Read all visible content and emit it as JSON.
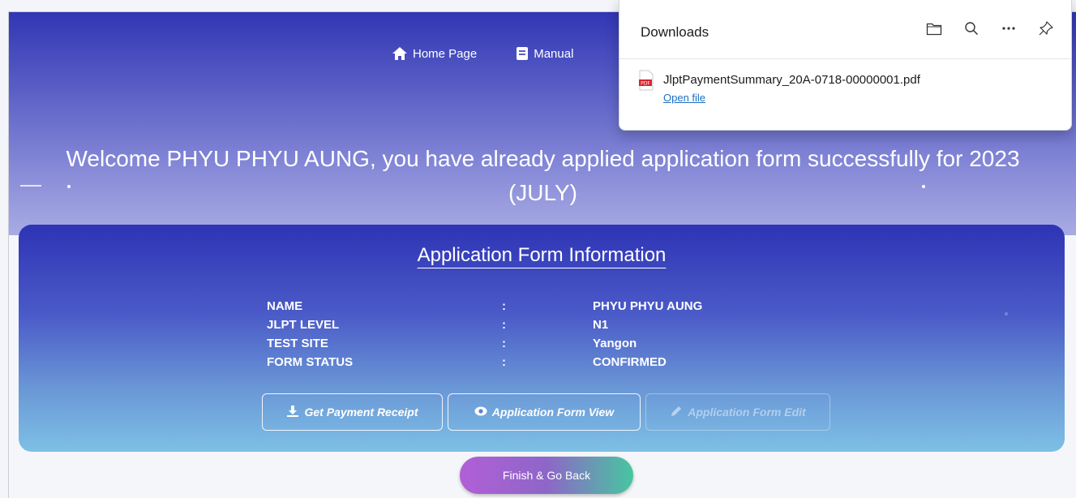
{
  "nav": {
    "home_label": "Home Page",
    "manual_label": "Manual"
  },
  "welcome": {
    "line1": "Welcome PHYU PHYU AUNG, you have already applied application form successfully for 2023",
    "line2": "(JULY)"
  },
  "card": {
    "title": "Application Form Information",
    "rows": [
      {
        "label": "NAME",
        "colon": ":",
        "value": "PHYU PHYU AUNG"
      },
      {
        "label": "JLPT LEVEL",
        "colon": ":",
        "value": "N1"
      },
      {
        "label": "TEST SITE",
        "colon": ":",
        "value": "Yangon"
      },
      {
        "label": "FORM STATUS",
        "colon": ":",
        "value": "CONFIRMED"
      }
    ],
    "buttons": {
      "receipt": "Get Payment Receipt",
      "view": "Application Form View",
      "edit": "Application Form Edit"
    }
  },
  "finish_label": "Finish & Go Back",
  "downloads": {
    "title": "Downloads",
    "file_name": "JlptPaymentSummary_20A-0718-00000001.pdf",
    "open_label": "Open file"
  },
  "colors": {
    "hero_top": "#3136b4",
    "card_bottom": "#7ec0e6",
    "link": "#1a6fc4"
  }
}
